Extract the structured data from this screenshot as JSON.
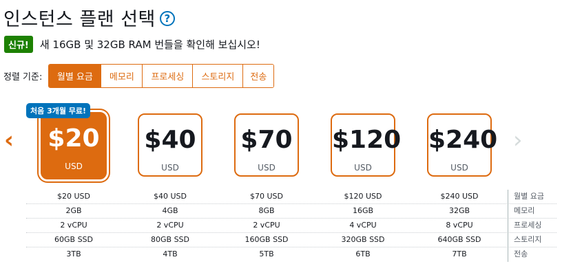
{
  "header": {
    "title": "인스턴스 플랜 선택",
    "help_icon": "?"
  },
  "notice": {
    "badge": "신규!",
    "text": "새 16GB 및 32GB RAM 번들을 확인해 보십시오!"
  },
  "sort": {
    "label": "정렬 기준:",
    "options": [
      "월별 요금",
      "메모리",
      "프로세싱",
      "스토리지",
      "전송"
    ],
    "active": "월별 요금"
  },
  "nav": {
    "prev_icon": "chevron-left",
    "next_icon": "chevron-right",
    "prev_glyph": "‹",
    "next_glyph": "›"
  },
  "plans": [
    {
      "price": "$20",
      "unit": "USD",
      "selected": true,
      "promo": "처음 3개월 무료!",
      "monthly": "$20 USD",
      "memory": "2GB",
      "processing": "2 vCPU",
      "storage": "60GB SSD",
      "transfer": "3TB"
    },
    {
      "price": "$40",
      "unit": "USD",
      "selected": false,
      "monthly": "$40 USD",
      "memory": "4GB",
      "processing": "2 vCPU",
      "storage": "80GB SSD",
      "transfer": "4TB"
    },
    {
      "price": "$70",
      "unit": "USD",
      "selected": false,
      "monthly": "$70 USD",
      "memory": "8GB",
      "processing": "2 vCPU",
      "storage": "160GB SSD",
      "transfer": "5TB"
    },
    {
      "price": "$120",
      "unit": "USD",
      "selected": false,
      "monthly": "$120 USD",
      "memory": "16GB",
      "processing": "4 vCPU",
      "storage": "320GB SSD",
      "transfer": "6TB"
    },
    {
      "price": "$240",
      "unit": "USD",
      "selected": false,
      "monthly": "$240 USD",
      "memory": "32GB",
      "processing": "8 vCPU",
      "storage": "640GB SSD",
      "transfer": "7TB"
    }
  ],
  "spec_labels": [
    "월별 요금",
    "메모리",
    "프로세싱",
    "스토리지",
    "전송"
  ],
  "colors": {
    "accent": "#dd6b10",
    "promo": "#0073bb",
    "new_badge": "#1d8102",
    "disabled": "#d5dbdb"
  }
}
